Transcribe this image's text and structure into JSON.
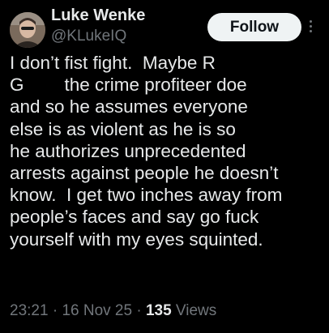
{
  "author": {
    "display_name": "Luke Wenke",
    "handle": "@KLukeIQ"
  },
  "header": {
    "follow_label": "Follow",
    "more_icon": "more-vertical-icon"
  },
  "tweet": {
    "lines": [
      "I don’t fist fight.  Maybe R",
      "G        the crime profiteer doe",
      "and so he assumes everyone",
      "else is as violent as he is so",
      "he authorizes unprecedented",
      "arrests against people he doesn’t",
      "know.  I get two inches away from",
      "people’s faces and say go fuck",
      "yourself with my eyes squinted."
    ]
  },
  "meta": {
    "time": "23:21",
    "separator": " · ",
    "date": "16 Nov 25",
    "views_count": "135",
    "views_label": " Views"
  },
  "colors": {
    "background": "#000000",
    "text_primary": "#e7e9ea",
    "text_secondary": "#71767b",
    "follow_bg": "#eff3f4",
    "follow_text": "#0f1419"
  }
}
